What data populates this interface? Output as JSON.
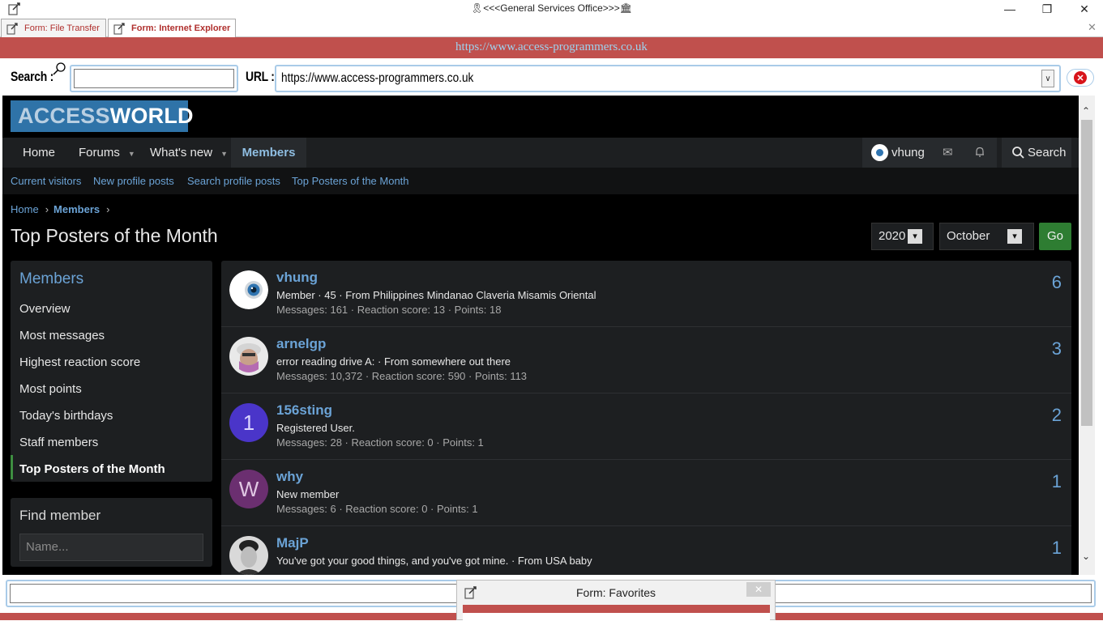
{
  "window": {
    "title": "🎗<<<General Services Office>>>🏛",
    "min_glyph": "—",
    "max_glyph": "❐",
    "close_glyph": "✕"
  },
  "tabs": [
    {
      "label": "Form: File Transfer"
    },
    {
      "label": "Form: Internet Explorer"
    }
  ],
  "tab_close_glyph": "✕",
  "banner": {
    "url": "https://www.access-programmers.co.uk"
  },
  "toolbar": {
    "search_label": "Search :",
    "search_value": "",
    "url_label": "URL :",
    "url_value": "https://www.access-programmers.co.uk",
    "dropdown_glyph": "∨",
    "stop_glyph": "✕"
  },
  "site": {
    "logo_access": "ACCESS",
    "logo_world": "WORLD",
    "nav": {
      "home": "Home",
      "forums": "Forums",
      "whats_new": "What's new",
      "members": "Members",
      "caret": "▼",
      "username": "vhung",
      "mail_glyph": "✉",
      "search": "Search"
    },
    "subnav": [
      "Current visitors",
      "New profile posts",
      "Search profile posts",
      "Top Posters of the Month"
    ],
    "breadcrumb": {
      "home": "Home",
      "members": "Members",
      "sep": "›"
    },
    "page_title": "Top Posters of the Month",
    "filter": {
      "year": "2020",
      "month": "October",
      "dd_glyph": "▾",
      "go": "Go"
    },
    "sidebar": {
      "title": "Members",
      "items": [
        "Overview",
        "Most messages",
        "Highest reaction score",
        "Most points",
        "Today's birthdays",
        "Staff members",
        "Top Posters of the Month"
      ]
    },
    "find": {
      "title": "Find member",
      "placeholder": "Name..."
    },
    "members": [
      {
        "name": "vhung",
        "line1": "Member · 45 · From Philippines Mindanao Claveria Misamis Oriental",
        "line2": "Messages: 161 · Reaction score: 13 · Points: 18",
        "count": "6",
        "avatar": "eye"
      },
      {
        "name": "arnelgp",
        "line1": "error reading drive A: · From somewhere out there",
        "line2": "Messages: 10,372 · Reaction score: 590 · Points: 113",
        "count": "3",
        "avatar": "photo"
      },
      {
        "name": "156sting",
        "line1": "Registered User.",
        "line2": "Messages: 28 · Reaction score: 0 · Points: 1",
        "count": "2",
        "avatar": "letter",
        "letter": "1",
        "color": "#4a35c9"
      },
      {
        "name": "why",
        "line1": "New member",
        "line2": "Messages: 6 · Reaction score: 0 · Points: 1",
        "count": "1",
        "avatar": "letter",
        "letter": "W",
        "color": "#6b2f70"
      },
      {
        "name": "MajP",
        "line1": "You've got your good things, and you've got mine. · From USA baby",
        "line2": "",
        "count": "1",
        "avatar": "photo2"
      }
    ]
  },
  "scroll": {
    "up": "⌃",
    "down": "⌄"
  },
  "favorites": {
    "title": "Form: Favorites",
    "close": "✕"
  }
}
